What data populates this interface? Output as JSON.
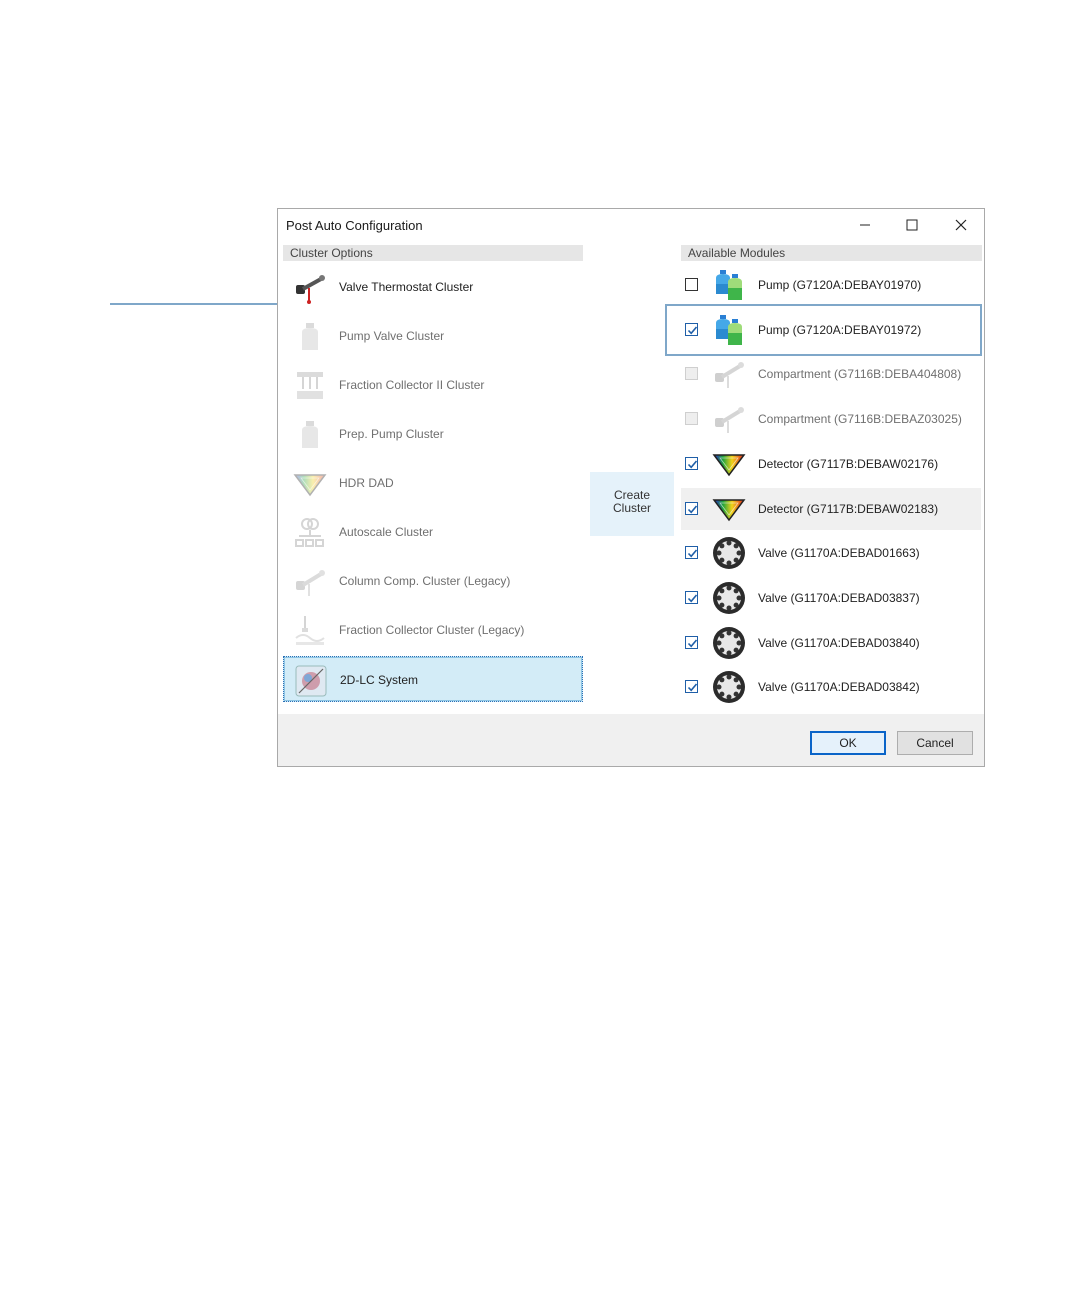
{
  "window": {
    "title": "Post Auto Configuration"
  },
  "cluster_options": {
    "header": "Cluster Options",
    "items": [
      {
        "label": "Valve Thermostat Cluster",
        "icon": "valve-thermostat-icon",
        "enabled": true,
        "selected": false
      },
      {
        "label": "Pump Valve Cluster",
        "icon": "pump-bottle-icon",
        "enabled": false,
        "selected": false
      },
      {
        "label": "Fraction Collector II Cluster",
        "icon": "fraction-collector-icon",
        "enabled": false,
        "selected": false
      },
      {
        "label": "Prep. Pump Cluster",
        "icon": "pump-bottle-icon",
        "enabled": false,
        "selected": false
      },
      {
        "label": "HDR DAD",
        "icon": "prism-icon",
        "enabled": false,
        "selected": false
      },
      {
        "label": "Autoscale Cluster",
        "icon": "autoscale-icon",
        "enabled": false,
        "selected": false
      },
      {
        "label": "Column Comp. Cluster (Legacy)",
        "icon": "column-compartment-icon",
        "enabled": false,
        "selected": false
      },
      {
        "label": "Fraction Collector Cluster (Legacy)",
        "icon": "fraction-collector-legacy-icon",
        "enabled": false,
        "selected": false
      },
      {
        "label": "2D-LC System",
        "icon": "2d-lc-system-icon",
        "enabled": true,
        "selected": true
      }
    ]
  },
  "create_cluster": {
    "label_line1": "Create",
    "label_line2": "Cluster"
  },
  "available_modules": {
    "header": "Available Modules",
    "items": [
      {
        "label": "Pump (G7120A:DEBAY01970)",
        "icon": "pump-bottles-icon",
        "checked": false,
        "enabled": true
      },
      {
        "label": "Pump (G7120A:DEBAY01972)",
        "icon": "pump-bottles-icon",
        "checked": true,
        "enabled": true,
        "highlighted": true
      },
      {
        "label": "Compartment (G7116B:DEBA404808)",
        "icon": "column-compartment-icon",
        "checked": false,
        "enabled": false
      },
      {
        "label": "Compartment (G7116B:DEBAZ03025)",
        "icon": "column-compartment-icon",
        "checked": false,
        "enabled": false
      },
      {
        "label": "Detector (G7117B:DEBAW02176)",
        "icon": "prism-icon",
        "checked": true,
        "enabled": true
      },
      {
        "label": "Detector (G7117B:DEBAW02183)",
        "icon": "prism-icon",
        "checked": true,
        "enabled": true,
        "hover": true
      },
      {
        "label": "Valve (G1170A:DEBAD01663)",
        "icon": "valve-wheel-icon",
        "checked": true,
        "enabled": true
      },
      {
        "label": "Valve (G1170A:DEBAD03837)",
        "icon": "valve-wheel-icon",
        "checked": true,
        "enabled": true
      },
      {
        "label": "Valve (G1170A:DEBAD03840)",
        "icon": "valve-wheel-icon",
        "checked": true,
        "enabled": true
      },
      {
        "label": "Valve (G1170A:DEBAD03842)",
        "icon": "valve-wheel-icon",
        "checked": true,
        "enabled": true
      }
    ]
  },
  "buttons": {
    "ok": "OK",
    "cancel": "Cancel"
  },
  "colors": {
    "accent": "#0a64c8",
    "selection": "#d3ecf7",
    "callout": "#7fa7c9"
  }
}
